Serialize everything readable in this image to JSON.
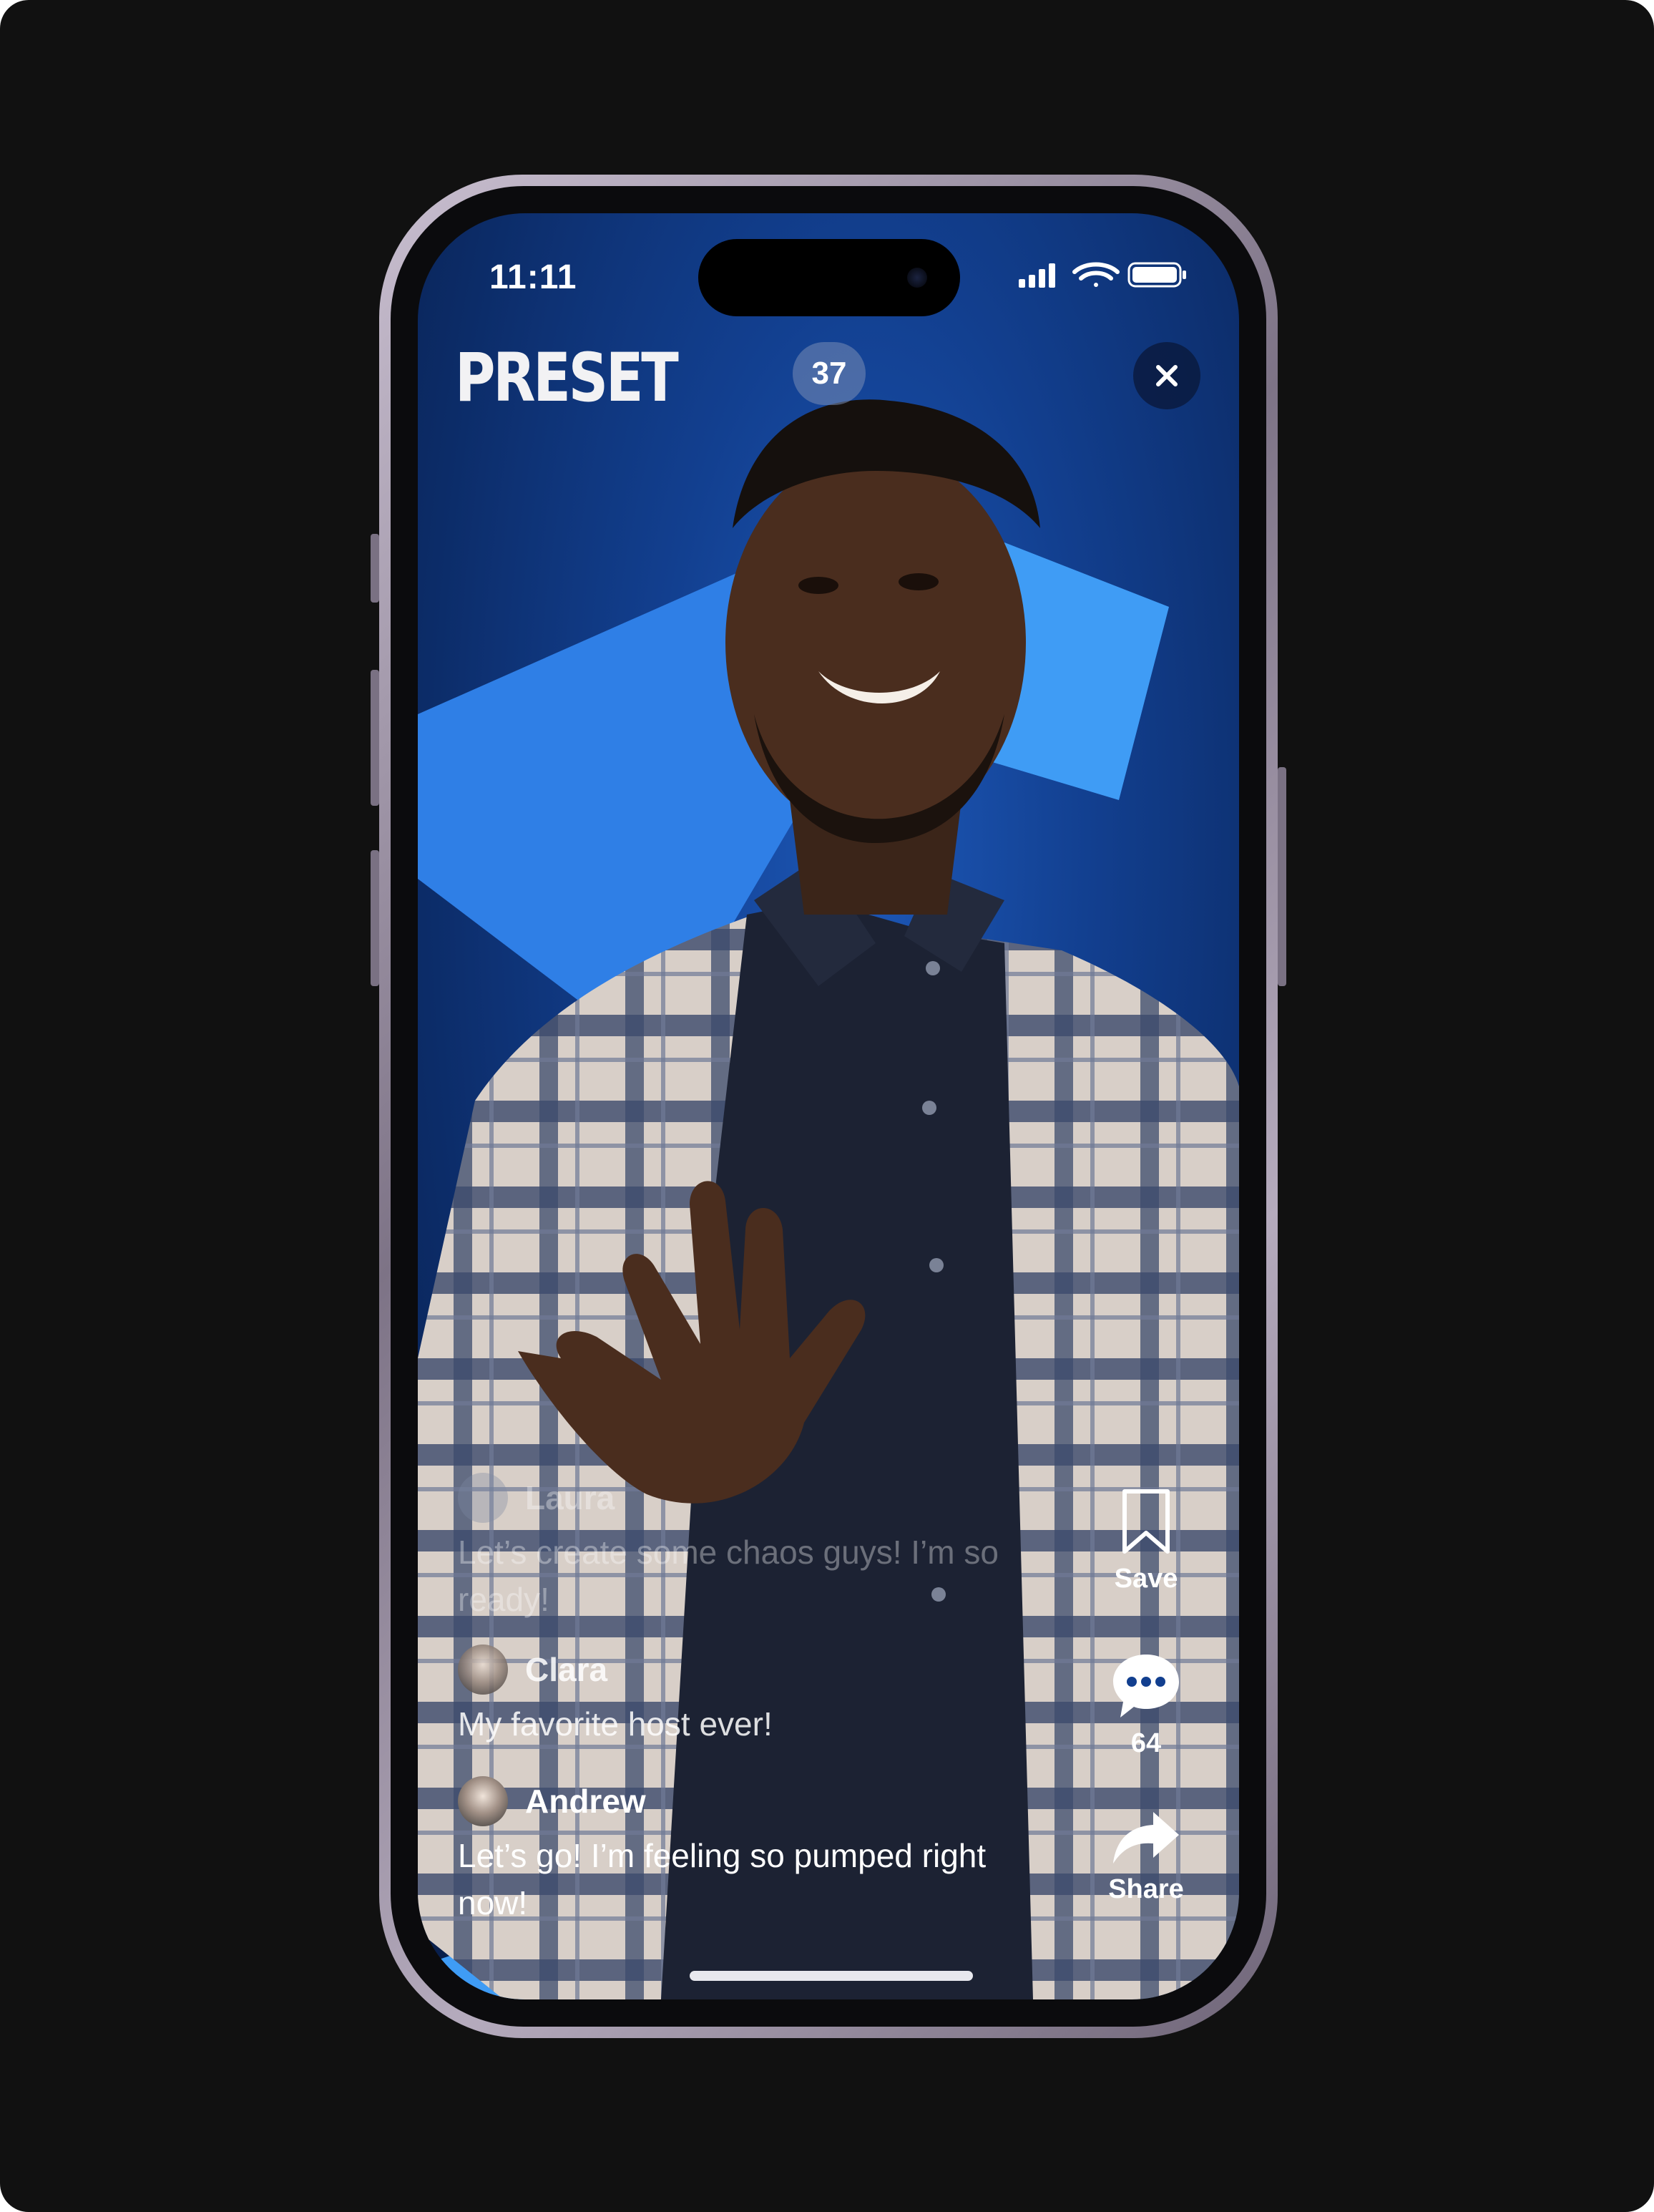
{
  "status_bar": {
    "time": "11:11"
  },
  "header": {
    "logo": "PRESET",
    "viewer_count": "37"
  },
  "chat": [
    {
      "name": "Laura",
      "message": "Let’s create some chaos guys! I’m so ready!",
      "faded": true
    },
    {
      "name": "Clara",
      "message": "My favorite host ever!",
      "faded": false
    },
    {
      "name": "Andrew",
      "message": "Let’s go! I’m feeling so pumped right now!",
      "faded": false
    }
  ],
  "actions": {
    "save_label": "Save",
    "comments_count": "64",
    "share_label": "Share"
  },
  "icons": {
    "close": "close-icon",
    "save": "bookmark-icon",
    "comments": "chat-bubble-icon",
    "share": "share-arrow-icon",
    "signal": "cellular-signal-icon",
    "wifi": "wifi-icon",
    "battery": "battery-icon"
  },
  "colors": {
    "background": "#111111",
    "screen_blue": "#123f8f",
    "accent_blue": "#3d8ef0"
  }
}
